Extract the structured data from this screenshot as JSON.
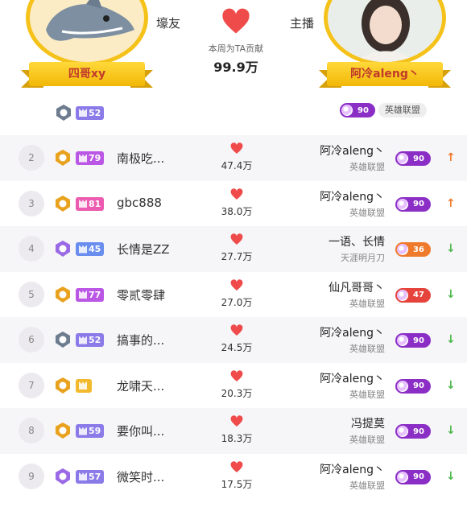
{
  "header": {
    "left_label": "壕友",
    "right_label": "主播",
    "contribution_label": "本周为TA贡献",
    "contribution_value": "99.9万",
    "fan": {
      "name": "四哥xy",
      "level": "52"
    },
    "anchor": {
      "name": "阿冷aleng丶",
      "level": "90",
      "game": "英雄联盟"
    }
  },
  "rows": [
    {
      "rank": "2",
      "user": "南极吃...",
      "level": "79",
      "lvl_color": "#bb57e5",
      "medal_color": "#e9a21e",
      "score": "47.4万",
      "anchor": "阿冷aleng丶",
      "game": "英雄联盟",
      "anchor_level": "90",
      "pill_color": "#8b2ec6",
      "trend": "up"
    },
    {
      "rank": "3",
      "user": "gbc888",
      "level": "81",
      "lvl_color": "#ec5bb0",
      "medal_color": "#e9a21e",
      "score": "38.0万",
      "anchor": "阿冷aleng丶",
      "game": "英雄联盟",
      "anchor_level": "90",
      "pill_color": "#8b2ec6",
      "trend": "up"
    },
    {
      "rank": "4",
      "user": "长情是ZZ",
      "level": "45",
      "lvl_color": "#6a8ef0",
      "medal_color": "#9a69e6",
      "score": "27.7万",
      "anchor": "一语、长情",
      "game": "天涯明月刀",
      "anchor_level": "36",
      "pill_color": "#f07a2c",
      "trend": "down"
    },
    {
      "rank": "5",
      "user": "零贰零肆",
      "level": "77",
      "lvl_color": "#bb57e5",
      "medal_color": "#e9a21e",
      "score": "27.0万",
      "anchor": "仙凡哥哥丶",
      "game": "英雄联盟",
      "anchor_level": "47",
      "pill_color": "#e5433b",
      "trend": "down"
    },
    {
      "rank": "6",
      "user": "搞事的...",
      "level": "52",
      "lvl_color": "#8a7be8",
      "medal_color": "#6d7c8f",
      "score": "24.5万",
      "anchor": "阿冷aleng丶",
      "game": "英雄联盟",
      "anchor_level": "90",
      "pill_color": "#8b2ec6",
      "trend": "down"
    },
    {
      "rank": "7",
      "user": "龙啸天...",
      "level": "",
      "lvl_color": "#f2b92d",
      "medal_color": "#e9a21e",
      "score": "20.3万",
      "anchor": "阿冷aleng丶",
      "game": "英雄联盟",
      "anchor_level": "90",
      "pill_color": "#8b2ec6",
      "trend": "down"
    },
    {
      "rank": "8",
      "user": "要你叫...",
      "level": "59",
      "lvl_color": "#8a7be8",
      "medal_color": "#e9a21e",
      "score": "18.3万",
      "anchor": "冯提莫",
      "game": "英雄联盟",
      "anchor_level": "90",
      "pill_color": "#8b2ec6",
      "trend": "down"
    },
    {
      "rank": "9",
      "user": "微笑时...",
      "level": "57",
      "lvl_color": "#8a7be8",
      "medal_color": "#9a69e6",
      "score": "17.5万",
      "anchor": "阿冷aleng丶",
      "game": "英雄联盟",
      "anchor_level": "90",
      "pill_color": "#8b2ec6",
      "trend": "down"
    }
  ],
  "colors": {
    "heart": "#f04b4b",
    "gold": "#f5c21a",
    "up": "#f07a2c",
    "down": "#4cb84c"
  }
}
